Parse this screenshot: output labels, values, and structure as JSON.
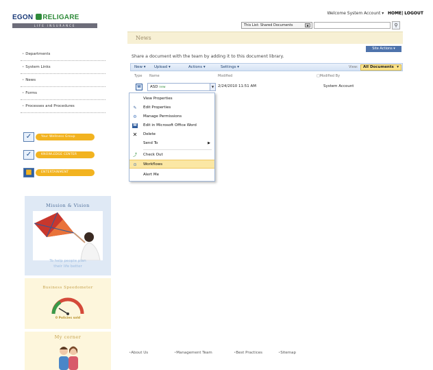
{
  "brand": {
    "logo_name_1": "EGON",
    "logo_name_2": "RELIGARE",
    "logo_tagline": "LIFE INSURANCE"
  },
  "header": {
    "welcome": "Welcome System Account",
    "home": "HOME",
    "logout": "LOGOUT",
    "search_scope": "This List: Shared Documents",
    "search_placeholder": ""
  },
  "page": {
    "title": "News",
    "site_actions": "Site Actions",
    "intro": "Share a document with the team by adding it to this document library."
  },
  "leftnav": {
    "items": [
      "Departments",
      "System Links",
      "News",
      "Forms",
      "Processes and Procedures"
    ]
  },
  "quicklinks": [
    {
      "label": "Your Wellness Group",
      "icon": "checkbox-icon"
    },
    {
      "label": "KNOWLEDGE CENTER",
      "icon": "checkbox-icon"
    },
    {
      "label": "ENTERTAINMENT",
      "icon": "book-icon"
    }
  ],
  "promos": {
    "mission_title": "Mission & Vision",
    "mission_text_1": "To help people plan",
    "mission_text_2": "their life better",
    "speedo_title": "Business Speedometer",
    "speedo_caption": "0 Policies sold",
    "corner_title": "My corner"
  },
  "toolbar": {
    "new": "New",
    "upload": "Upload",
    "actions": "Actions",
    "settings": "Settings",
    "view_label": "View:",
    "view_value": "All Documents"
  },
  "list": {
    "columns": [
      "Type",
      "Name",
      "Modified",
      "Modified By"
    ],
    "rows": [
      {
        "name": "ASD",
        "badge": "new",
        "modified": "2/24/2010 11:51 AM",
        "modified_by": "System Account"
      }
    ]
  },
  "context_menu": {
    "items": [
      {
        "label": "View Properties",
        "icon": ""
      },
      {
        "label": "Edit Properties",
        "icon": "edit-properties-icon"
      },
      {
        "label": "Manage Permissions",
        "icon": "permissions-icon"
      },
      {
        "label": "Edit in Microsoft Office Word",
        "icon": "word-icon"
      },
      {
        "label": "Delete",
        "icon": "delete-icon"
      },
      {
        "label": "Send To",
        "icon": ""
      },
      {
        "label": "Check Out",
        "icon": "check-out-icon"
      },
      {
        "label": "Workflows",
        "icon": "workflows-icon"
      },
      {
        "label": "Alert Me",
        "icon": ""
      }
    ],
    "highlighted": "Workflows"
  },
  "footer": {
    "links": [
      "About Us",
      "Management Team",
      "Best Practices",
      "Sitemap"
    ]
  },
  "colors": {
    "toolbar_blue": "#d4e2f4",
    "highlight": "#fbe7a4",
    "accent_yellow": "#f2b320",
    "brand_navy": "#1a3a78",
    "brand_green": "#2f8b3a"
  }
}
